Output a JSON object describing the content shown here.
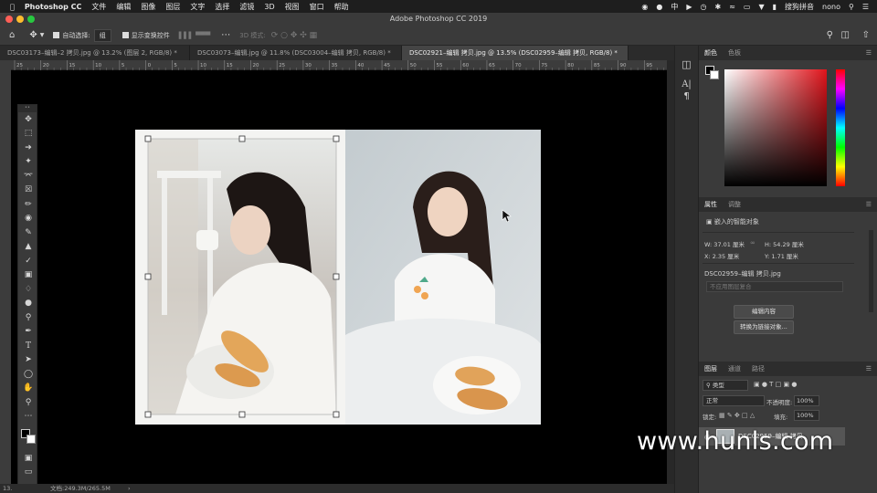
{
  "menubar": {
    "items": [
      "Photoshop CC",
      "文件",
      "编辑",
      "图像",
      "图层",
      "文字",
      "选择",
      "滤镜",
      "3D",
      "视图",
      "窗口",
      "帮助"
    ],
    "input_method": "搜狗拼音",
    "user": "nono",
    "ime_glyph": "中"
  },
  "window": {
    "title": "Adobe Photoshop CC 2019"
  },
  "options": {
    "auto_select_label": "自动选择:",
    "auto_select_value": "组",
    "show_transform_label": "显示变换控件",
    "mode_3d_label": "3D 模式:"
  },
  "tabs": [
    "DSC03173–编辑–2 拷贝.jpg @ 13.2% (图层 2, RGB/8) *",
    "DSC03073–编辑.jpg @ 11.8% (DSC03004–编辑 拷贝, RGB/8) *",
    "DSC02921–编辑 拷贝.jpg @ 13.5% (DSC02959–编辑 拷贝, RGB/8) *"
  ],
  "ruler_ticks": [
    "25",
    "20",
    "15",
    "10",
    "5",
    "0",
    "5",
    "10",
    "15",
    "20",
    "25",
    "30",
    "35",
    "40",
    "45",
    "50",
    "55",
    "60",
    "65",
    "70",
    "75",
    "80",
    "85",
    "90",
    "95"
  ],
  "status": {
    "zoom": "13.",
    "doc": "文档:249.3M/265.5M"
  },
  "panels": {
    "color_tabs": [
      "颜色",
      "色板"
    ],
    "props_tabs": [
      "属性",
      "调整"
    ],
    "smart_object_label": "嵌入的智能对象",
    "w": "W:  37.01 厘米",
    "h": "H:  54.29 厘米",
    "x": "X:  2.35 厘米",
    "y": "Y:  1.71 厘米",
    "source_file": "DSC02959–编辑 拷贝.jpg",
    "layer_comp_placeholder": "不应用图层复合",
    "edit_contents_button": "编辑内容",
    "convert_button": "转换为链接对象...",
    "layers_tabs": [
      "图层",
      "通道",
      "路径"
    ],
    "filter_kind": "类型",
    "blend_mode": "正常",
    "opacity_label": "不透明度:",
    "opacity_value": "100%",
    "lock_label": "锁定:",
    "fill_label": "填充:",
    "fill_value": "100%",
    "layer_name": "DSC02959–编辑 拷贝"
  },
  "watermark": "www.hunls.com",
  "colors": {
    "accent_close": "#ff5f57",
    "accent_min": "#febc2e",
    "accent_max": "#28c840"
  }
}
